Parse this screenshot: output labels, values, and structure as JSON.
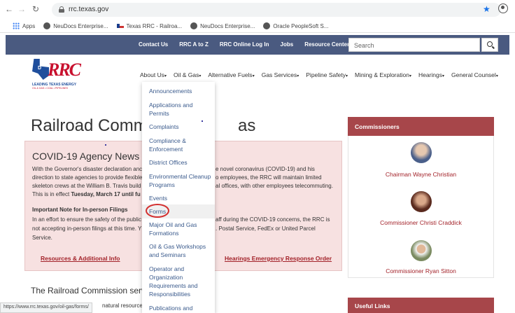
{
  "browser": {
    "url": "rrc.texas.gov",
    "bookmarks": [
      "Apps",
      "NeuDocs Enterprise...",
      "Texas RRC - Railroa...",
      "NeuDocs Enterprise...",
      "Oracle PeopleSoft S..."
    ],
    "status_url": "https://www.rrc.texas.gov/oil-gas/forms/"
  },
  "topbar": {
    "links": [
      "Contact Us",
      "RRC A to Z",
      "RRC Online Log In",
      "Jobs",
      "Resource Center"
    ],
    "search_placeholder": "Search"
  },
  "logo": {
    "letters": "RRC",
    "d_mark": "D",
    "tagline": "LEADING TEXAS ENERGY",
    "subtagline": "OIL & GAS • COAL • PIPELINES"
  },
  "mainnav": {
    "items": [
      "About Us",
      "Oil & Gas",
      "Alternative Fuels",
      "Gas Services",
      "Pipeline Safety",
      "Mining & Exploration",
      "Hearings",
      "General Counsel"
    ],
    "caret": "▾"
  },
  "page": {
    "title_left": "Railroad Commis",
    "title_right": "as"
  },
  "covid": {
    "heading": "COVID-19 Agency News",
    "lines_left": [
      "With the Governor's disaster declaration anc",
      "direction to state agencies to provide flexible",
      "skeleton crews at the William B. Travis build",
      "This is in effect "
    ],
    "effect_bold": "Tuesday, March 17 until fu",
    "lines_right": [
      "e novel coronavirus (COVID-19) and his",
      "o employees, the RRC will maintain limited",
      "al offices, with other employees telecommuting."
    ],
    "note_heading": "Important Note for In-person Filings",
    "note_left": [
      "In an effort to ensure the safety of the public",
      "not accepting in-person filings at this time. Y",
      "Service."
    ],
    "note_right": [
      "aff during the COVID-19 concerns, the RRC is",
      ". Postal Service, FedEx or United Parcel"
    ],
    "link_resources": "Resources & Additional Info",
    "link_hearings": "Hearings Emergency Response Order"
  },
  "serves": {
    "text": "The Railroad Commission serves T",
    "fragment": "natural resources a"
  },
  "sidebar": {
    "commissioners_title": "Commissioners",
    "commissioners": [
      "Chairman Wayne Christian",
      "Commissioner Christi Craddick",
      "Commissioner Ryan Sitton"
    ],
    "useful_links_title": "Useful Links"
  },
  "dropdown": {
    "items": [
      [
        "Announcements"
      ],
      [
        "Applications and",
        "Permits"
      ],
      [
        "Complaints"
      ],
      [
        "Compliance &",
        "Enforcement"
      ],
      [
        "District Offices"
      ],
      [
        "Environmental Cleanup",
        "Programs"
      ],
      [
        "Events"
      ],
      [
        "Forms"
      ],
      [
        "Major Oil and Gas",
        "Formations"
      ],
      [
        "Oil & Gas Workshops",
        "and Seminars"
      ],
      [
        "Operator and",
        "Organization",
        "Requirements and",
        "Responsibilities"
      ],
      [
        "Publications and"
      ]
    ]
  }
}
